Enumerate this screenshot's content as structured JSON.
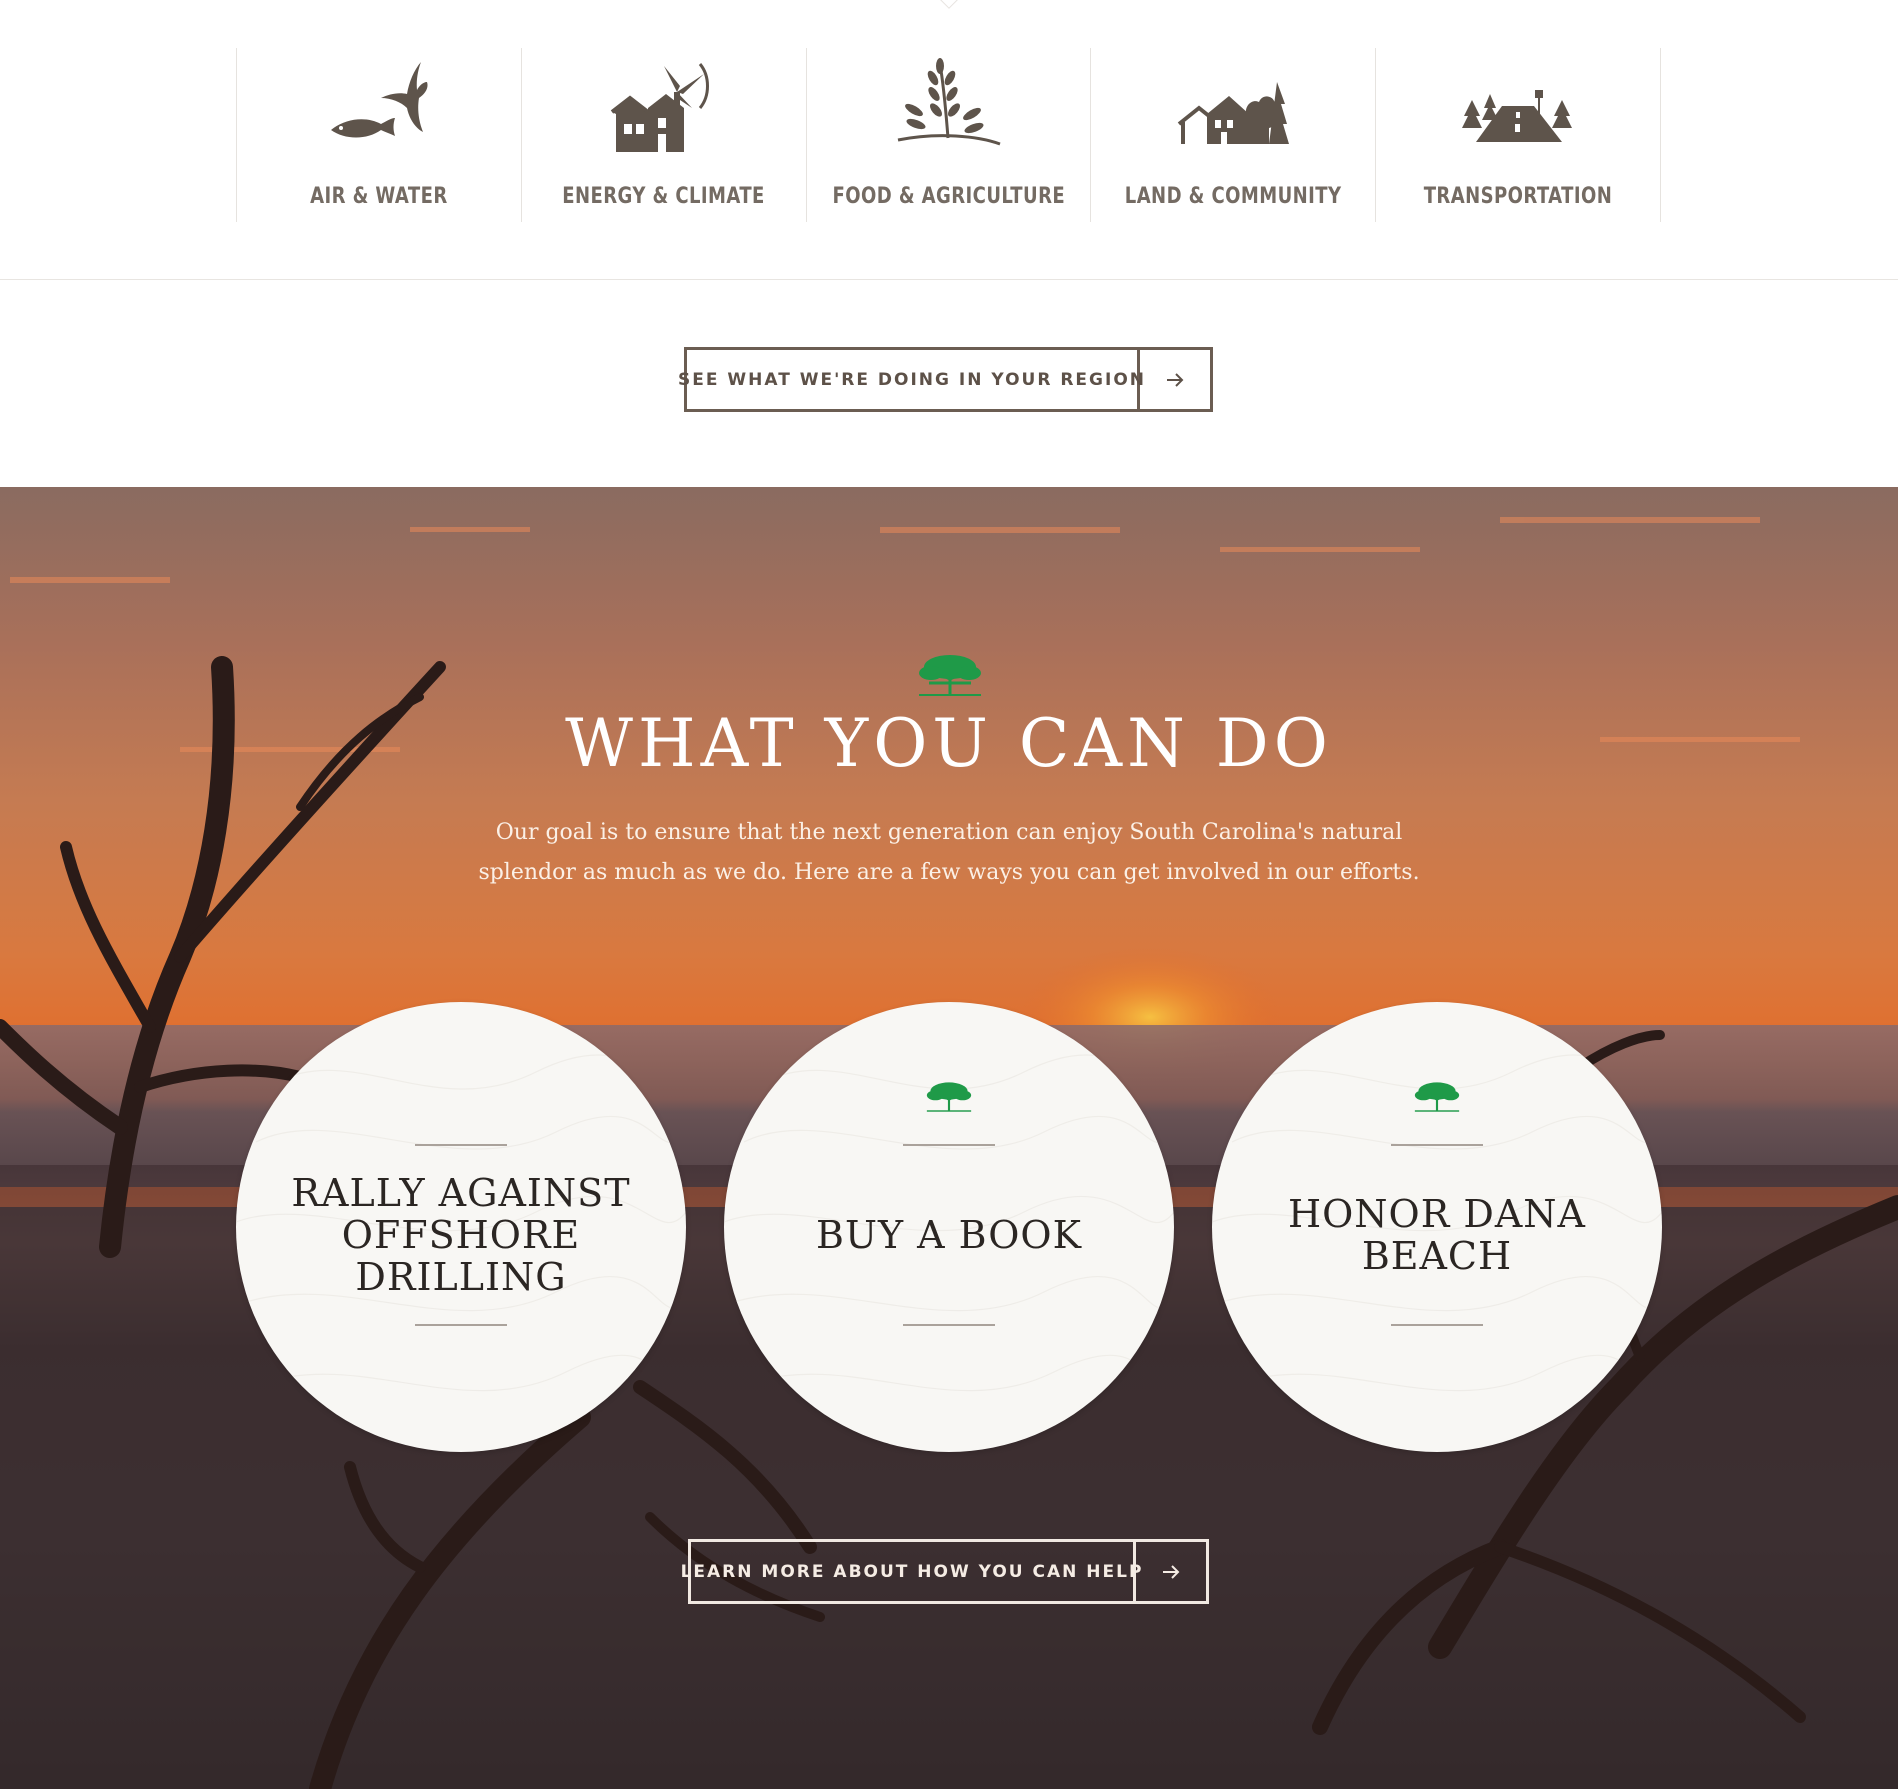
{
  "issues": [
    {
      "label": "AIR & WATER",
      "icon": "bird-fish-icon"
    },
    {
      "label": "ENERGY & CLIMATE",
      "icon": "wind-turbine-house-icon"
    },
    {
      "label": "FOOD & AGRICULTURE",
      "icon": "wheat-icon"
    },
    {
      "label": "LAND & COMMUNITY",
      "icon": "houses-tree-icon"
    },
    {
      "label": "TRANSPORTATION",
      "icon": "road-trees-icon"
    }
  ],
  "region_button": {
    "label": "SEE WHAT WE'RE DOING IN YOUR REGION",
    "arrow": "→"
  },
  "hero": {
    "title": "WHAT YOU CAN DO",
    "copy": "Our goal is to ensure that the next generation can enjoy South Carolina's natural splendor as much as we do. Here are a few ways you can get involved in our efforts.",
    "cards": [
      {
        "title": "RALLY AGAINST OFFSHORE DRILLING",
        "has_icon": false
      },
      {
        "title": "BUY A BOOK",
        "has_icon": true
      },
      {
        "title": "HONOR DANA BEACH",
        "has_icon": true
      }
    ],
    "help_button": {
      "label": "LEARN MORE ABOUT HOW YOU CAN HELP",
      "arrow": "→"
    }
  },
  "colors": {
    "icon_brown": "#5e544b",
    "label_brown": "#746b63",
    "tree_green": "#1f9a48"
  }
}
